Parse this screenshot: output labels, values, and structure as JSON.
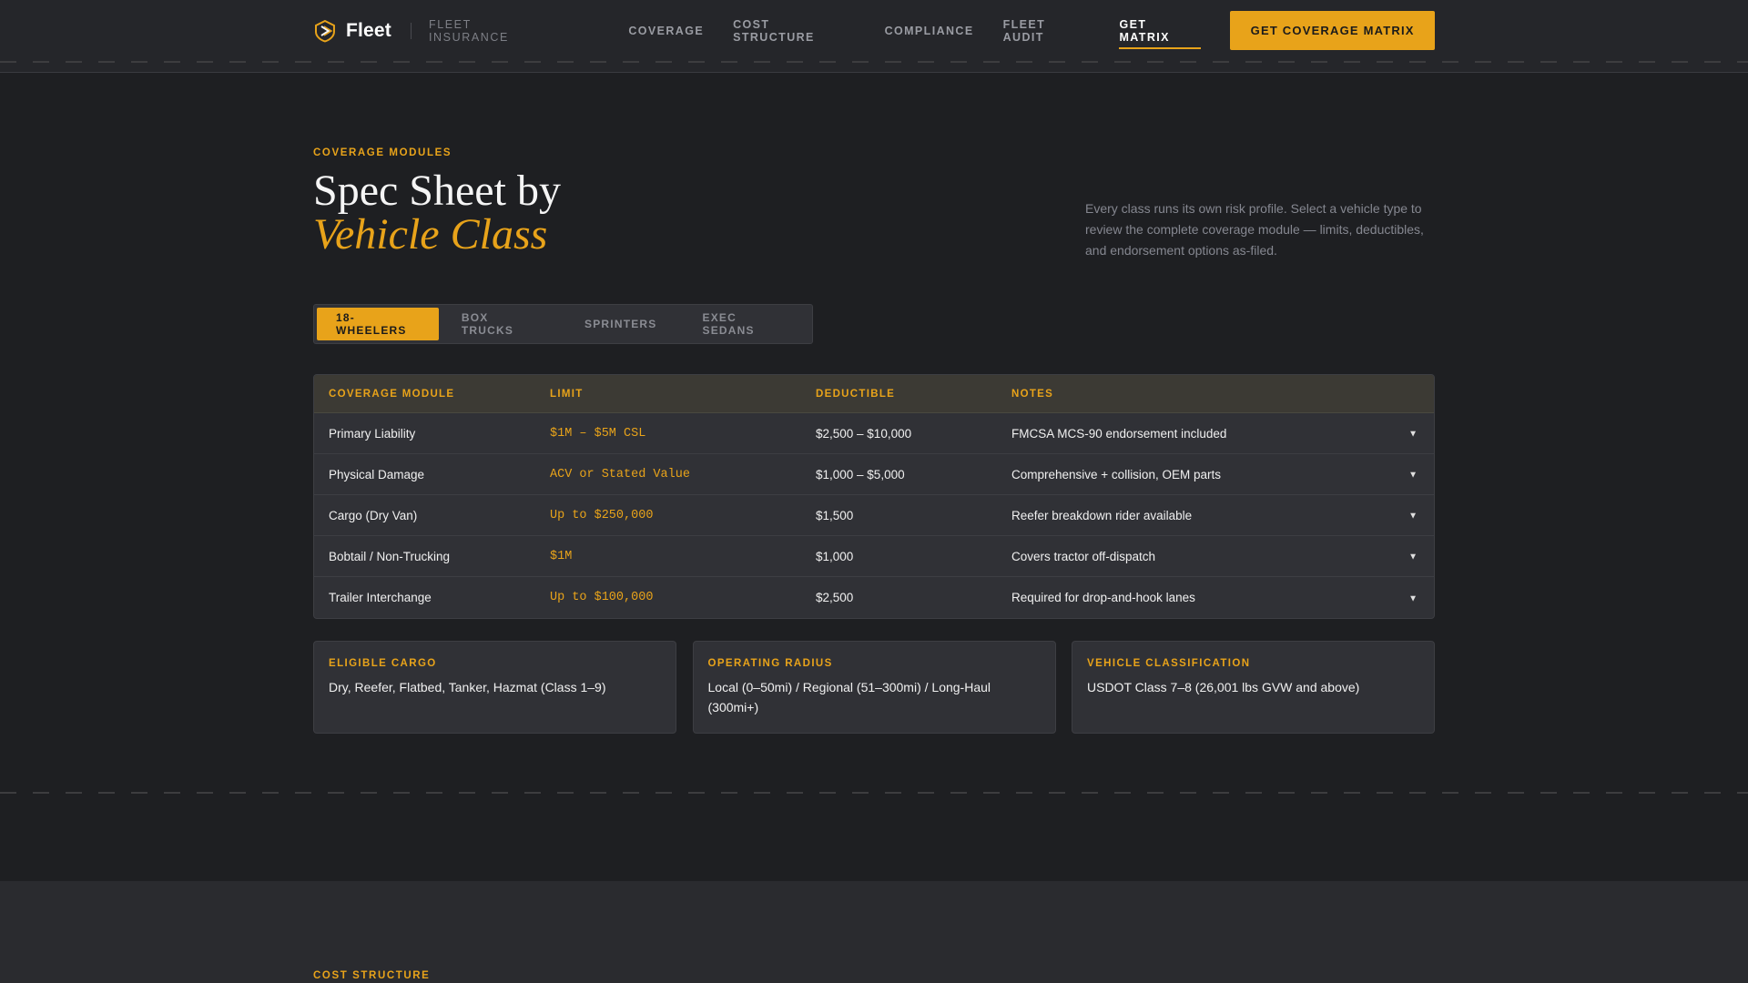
{
  "nav": {
    "brand": "Fleet",
    "brand_sub": "FLEET INSURANCE",
    "links": [
      "COVERAGE",
      "COST STRUCTURE",
      "COMPLIANCE",
      "FLEET AUDIT",
      "GET MATRIX"
    ],
    "active_link": "GET MATRIX",
    "cta": "GET COVERAGE MATRIX"
  },
  "hero": {
    "eyebrow": "COVERAGE MODULES",
    "title_line1": "Spec Sheet by",
    "title_line2": "Vehicle Class",
    "description": "Every class runs its own risk profile. Select a vehicle type to review the complete coverage module — limits, deductibles, and endorsement options as-filed."
  },
  "tabs": [
    "18-WHEELERS",
    "BOX TRUCKS",
    "SPRINTERS",
    "EXEC SEDANS"
  ],
  "active_tab": "18-WHEELERS",
  "table": {
    "headers": [
      "COVERAGE MODULE",
      "LIMIT",
      "DEDUCTIBLE",
      "NOTES"
    ],
    "rows": [
      {
        "module": "Primary Liability",
        "limit": "$1M – $5M CSL",
        "deductible": "$2,500 – $10,000",
        "notes": "FMCSA MCS-90 endorsement included"
      },
      {
        "module": "Physical Damage",
        "limit": "ACV or Stated Value",
        "deductible": "$1,000 – $5,000",
        "notes": "Comprehensive + collision, OEM parts"
      },
      {
        "module": "Cargo (Dry Van)",
        "limit": "Up to $250,000",
        "deductible": "$1,500",
        "notes": "Reefer breakdown rider available"
      },
      {
        "module": "Bobtail / Non-Trucking",
        "limit": "$1M",
        "deductible": "$1,000",
        "notes": "Covers tractor off-dispatch"
      },
      {
        "module": "Trailer Interchange",
        "limit": "Up to $100,000",
        "deductible": "$2,500",
        "notes": "Required for drop-and-hook lanes"
      }
    ],
    "expand_glyph": "▼"
  },
  "cards": [
    {
      "label": "ELIGIBLE CARGO",
      "value": "Dry, Reefer, Flatbed, Tanker, Hazmat (Class 1–9)"
    },
    {
      "label": "OPERATING RADIUS",
      "value": "Local (0–50mi) / Regional (51–300mi) / Long-Haul (300mi+)"
    },
    {
      "label": "VEHICLE CLASSIFICATION",
      "value": "USDOT Class 7–8 (26,001 lbs GVW and above)"
    }
  ],
  "next_section": {
    "eyebrow": "COST STRUCTURE"
  },
  "colors": {
    "accent": "#e8a31a",
    "background": "#1e1f22",
    "panel": "#303136"
  },
  "icons": {
    "brand": "shield-logo-icon",
    "row_expand": "chevron-down-icon"
  }
}
